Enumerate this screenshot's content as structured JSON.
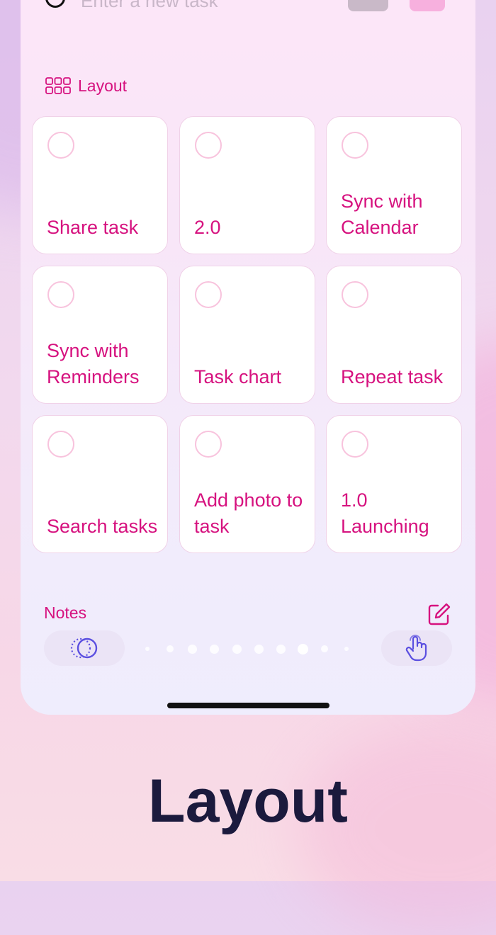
{
  "top": {
    "input_placeholder": "Enter a new task"
  },
  "section": {
    "label": "Layout",
    "icon": "grid-icon"
  },
  "cards": [
    {
      "text": "Share task"
    },
    {
      "text": "2.0"
    },
    {
      "text": "Sync with Calendar"
    },
    {
      "text": "Sync with Reminders"
    },
    {
      "text": "Task chart"
    },
    {
      "text": "Repeat task"
    },
    {
      "text": "Search tasks"
    },
    {
      "text": "Add photo to task"
    },
    {
      "text": "1.0 Launching"
    }
  ],
  "bottom": {
    "notes_label": "Notes",
    "left_pill_icon": "layers-icon",
    "right_pill_icon": "hand-pointer-icon",
    "edit_icon": "edit-icon",
    "page_count": 10,
    "active_page": 8
  },
  "caption": "Layout",
  "colors": {
    "accent": "#d6127f",
    "ring": "#f8c3dd",
    "pill_icon": "#5b4fe0",
    "title": "#1b1a3d"
  }
}
